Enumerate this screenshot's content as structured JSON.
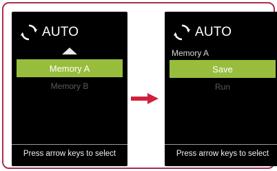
{
  "left_screen": {
    "header": {
      "title": "AUTO",
      "icon": "refresh-icon"
    },
    "up_arrow_icon": "triangle-up-icon",
    "selected_item": "Memory A",
    "secondary_item": "Memory B",
    "footer_hint": "Press arrow keys to select"
  },
  "right_screen": {
    "header": {
      "title": "AUTO",
      "icon": "refresh-icon"
    },
    "breadcrumb": "Memory A",
    "selected_item": "Save",
    "secondary_item": "Run",
    "footer_hint": "Press arrow keys to select"
  },
  "transition_arrow": {
    "icon": "arrow-right-icon",
    "color": "#d21f3c"
  },
  "colors": {
    "frame_border": "#a72d4a",
    "screen_bg": "#000000",
    "highlight": "#98bd3d",
    "dim_text": "#5b5b5b"
  }
}
